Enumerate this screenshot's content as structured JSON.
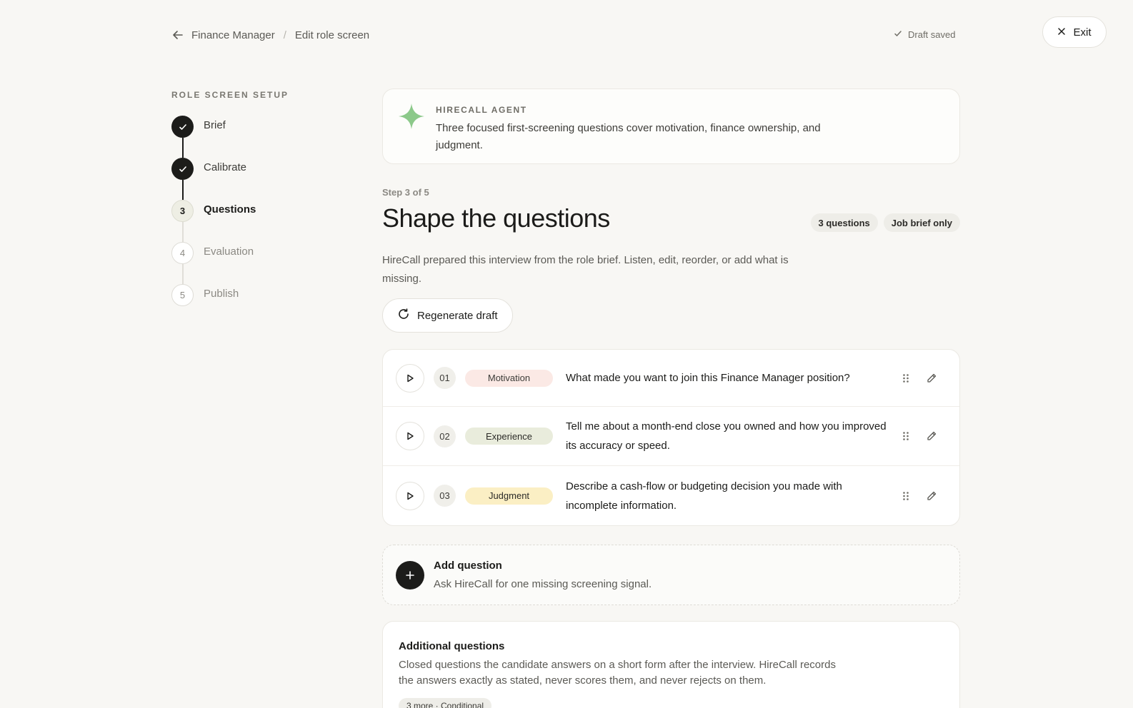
{
  "breadcrumb": {
    "parent": "Finance Manager",
    "separator": "/",
    "current": "Edit role screen"
  },
  "status": {
    "draft_saved": "Draft saved"
  },
  "exit_label": "Exit",
  "sidebar": {
    "label": "ROLE SCREEN SETUP",
    "steps": [
      {
        "number": "1",
        "label": "Brief",
        "state": "done"
      },
      {
        "number": "2",
        "label": "Calibrate",
        "state": "done"
      },
      {
        "number": "3",
        "label": "Questions",
        "state": "current"
      },
      {
        "number": "4",
        "label": "Evaluation",
        "state": "todo"
      },
      {
        "number": "5",
        "label": "Publish",
        "state": "todo"
      }
    ]
  },
  "agent": {
    "title": "HIRECALL AGENT",
    "message": "Three focused first-screening questions cover motivation, finance ownership, and judgment.",
    "accent_color": "#8cc98a"
  },
  "header": {
    "step_of": "Step 3 of 5",
    "title": "Shape the questions",
    "badges": [
      "3 questions",
      "Job brief only"
    ],
    "intro": "HireCall prepared this interview from the role brief. Listen, edit, reorder, or add what is missing.",
    "regenerate_label": "Regenerate draft"
  },
  "questions": [
    {
      "number": "01",
      "category": "Motivation",
      "text": "What made you want to join this Finance Manager position?"
    },
    {
      "number": "02",
      "category": "Experience",
      "text": "Tell me about a month-end close you owned and how you improved its accuracy or speed."
    },
    {
      "number": "03",
      "category": "Judgment",
      "text": "Describe a cash-flow or budgeting decision you made with incomplete information."
    }
  ],
  "add_question": {
    "title": "Add question",
    "subtitle": "Ask HireCall for one missing screening signal."
  },
  "additional": {
    "title": "Additional questions",
    "description": "Closed questions the candidate answers on a short form after the interview. HireCall records the answers exactly as stated, never scores them, and never rejects on them.",
    "badge": "3 more · Conditional"
  }
}
